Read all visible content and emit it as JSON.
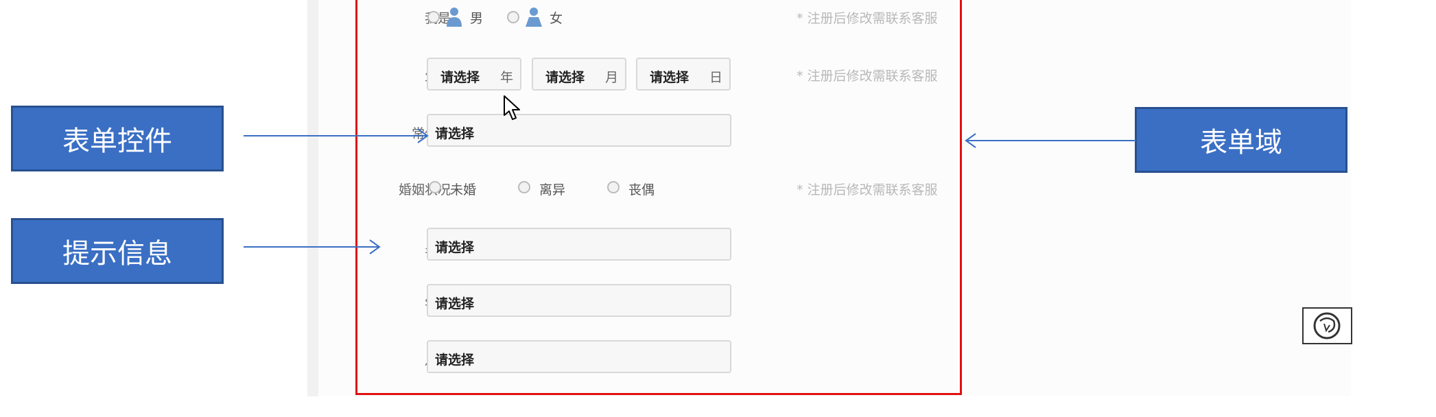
{
  "form": {
    "gender": {
      "label": "我是",
      "options": [
        "男",
        "女"
      ],
      "hint": "* 注册后修改需联系客服"
    },
    "birthday": {
      "label": "生日",
      "year": {
        "placeholder": "请选择",
        "unit": "年"
      },
      "month": {
        "placeholder": "请选择",
        "unit": "月"
      },
      "day": {
        "placeholder": "请选择",
        "unit": "日"
      },
      "hint": "* 注册后修改需联系客服"
    },
    "residence": {
      "label": "常住地",
      "placeholder": "请选择"
    },
    "marital": {
      "label": "婚姻状况",
      "options": [
        "未婚",
        "离异",
        "丧偶"
      ],
      "hint": "* 注册后修改需联系客服"
    },
    "height": {
      "label": "身高",
      "placeholder": "请选择"
    },
    "education": {
      "label": "学历",
      "placeholder": "请选择"
    },
    "salary": {
      "label": "月薪",
      "placeholder": "请选择"
    }
  },
  "annotations": {
    "form_control": "表单控件",
    "hint_info": "提示信息",
    "form_domain": "表单域"
  },
  "colors": {
    "frame": "#e01010",
    "note_fill": "#3a6fc4",
    "arrow": "#3a6fc4"
  },
  "icons": [
    "male-user-icon",
    "female-user-icon",
    "mouse-cursor-icon",
    "app-badge-icon"
  ]
}
